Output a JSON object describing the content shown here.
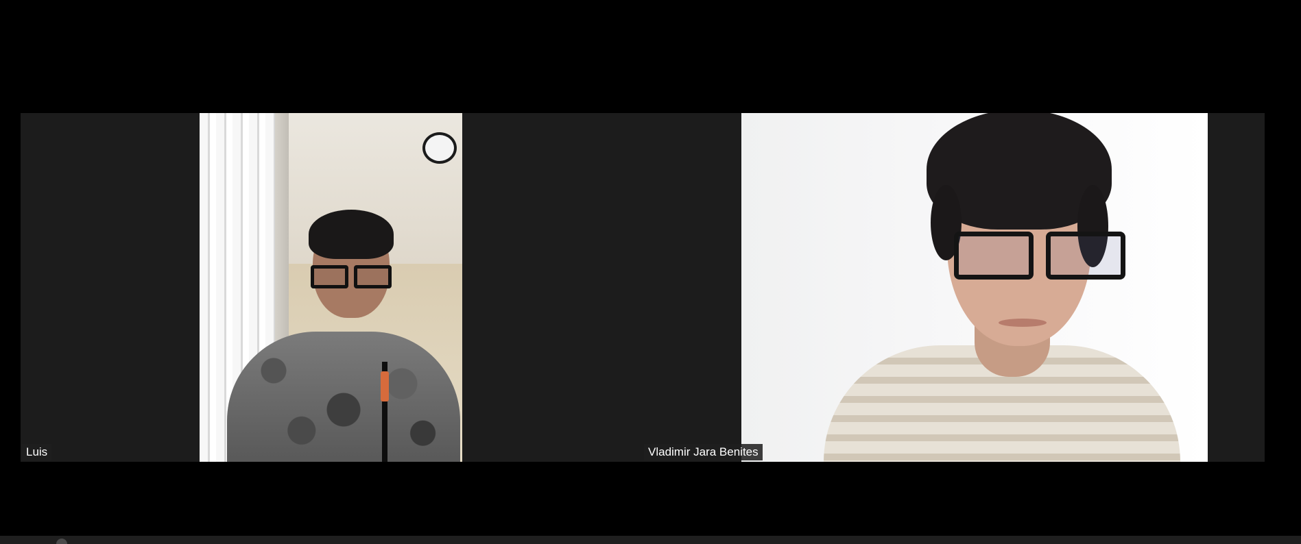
{
  "meeting": {
    "participants": [
      {
        "name": "Luis"
      },
      {
        "name": "Vladimir Jara Benites"
      }
    ]
  },
  "icons": {
    "bottom_toolbar_icon": "circle-icon"
  },
  "colors": {
    "background": "#000000",
    "tile_background": "#1c1c1c",
    "name_tag_background": "#1e1e1e",
    "name_tag_text": "#ffffff"
  }
}
